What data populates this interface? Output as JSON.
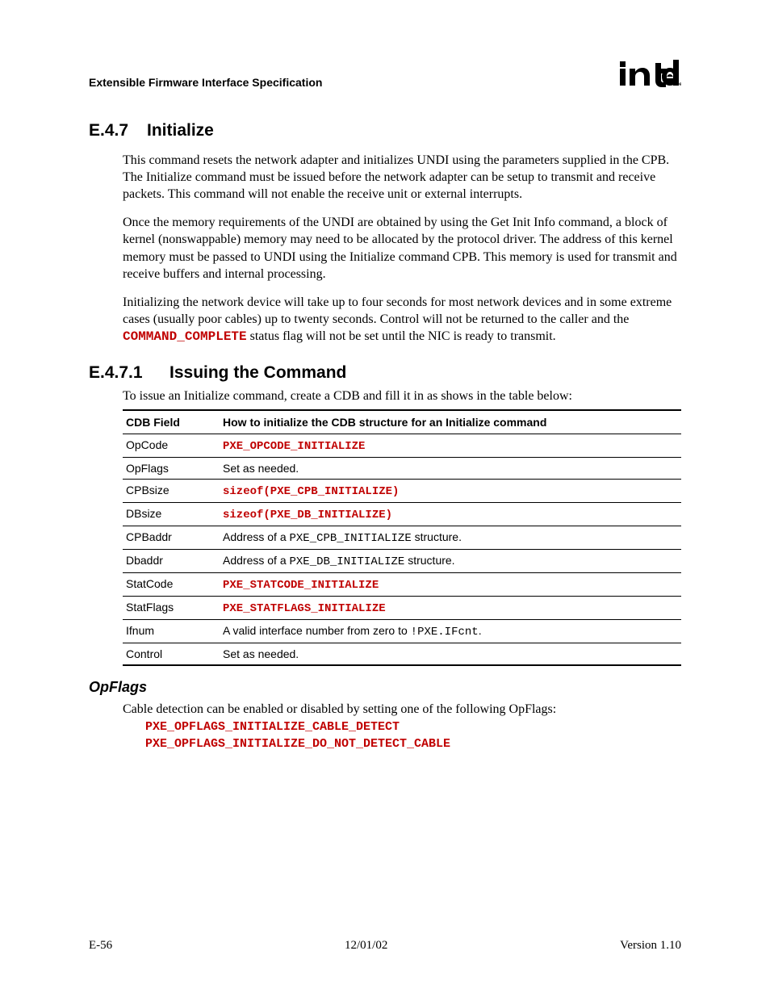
{
  "header": {
    "doc_title": "Extensible Firmware Interface Specification",
    "logo_alt": "intel"
  },
  "section": {
    "num": "E.4.7",
    "title": "Initialize",
    "paras": [
      "This command resets the network adapter and initializes UNDI using the parameters supplied in the CPB.  The Initialize command must be issued before the network adapter can be setup to transmit and receive packets.  This command will not enable the receive unit or external interrupts.",
      "Once the memory requirements of the UNDI are obtained by using the Get Init Info command, a block of kernel (nonswappable) memory may need to be allocated by the protocol driver.  The address of this kernel memory must be passed to UNDI using the Initialize command CPB.  This memory is used for transmit and receive buffers and internal processing."
    ],
    "para3_pre": "Initializing the network device will take up to four seconds for most network devices and in some extreme cases (usually poor cables) up to twenty seconds.  Control will not be returned to the caller and the ",
    "para3_code": "COMMAND_COMPLETE",
    "para3_post": " status flag will not be set until the NIC is ready to transmit."
  },
  "sub": {
    "num": "E.4.7.1",
    "title": "Issuing the Command",
    "intro": "To issue an Initialize command, create a CDB and fill it in as shows in the table below:"
  },
  "table": {
    "col1": "CDB Field",
    "col2": "How to initialize the CDB structure for an Initialize command",
    "rows": {
      "r0": {
        "f": "OpCode",
        "v_code": "PXE_OPCODE_INITIALIZE"
      },
      "r1": {
        "f": "OpFlags",
        "v_text": "Set as needed."
      },
      "r2": {
        "f": "CPBsize",
        "v_code": "sizeof(PXE_CPB_INITIALIZE)"
      },
      "r3": {
        "f": "DBsize",
        "v_code": "sizeof(PXE_DB_INITIALIZE)"
      },
      "r4": {
        "f": "CPBaddr",
        "v_pre": "Address of a ",
        "v_code": "PXE_CPB_INITIALIZE",
        "v_post": " structure."
      },
      "r5": {
        "f": "Dbaddr",
        "v_pre": "Address of a ",
        "v_code": "PXE_DB_INITIALIZE",
        "v_post": " structure."
      },
      "r6": {
        "f": "StatCode",
        "v_code": "PXE_STATCODE_INITIALIZE"
      },
      "r7": {
        "f": "StatFlags",
        "v_code": "PXE_STATFLAGS_INITIALIZE"
      },
      "r8": {
        "f": "Ifnum",
        "v_pre": "A valid interface number from zero to ",
        "v_code": "!PXE.IFcnt",
        "v_post": "."
      },
      "r9": {
        "f": "Control",
        "v_text": "Set as needed."
      }
    }
  },
  "opflags": {
    "heading": "OpFlags",
    "intro": "Cable detection can be enabled or disabled by setting one of the following OpFlags:",
    "line1": "PXE_OPFLAGS_INITIALIZE_CABLE_DETECT",
    "line2": "PXE_OPFLAGS_INITIALIZE_DO_NOT_DETECT_CABLE"
  },
  "footer": {
    "left": "E-56",
    "center": "12/01/02",
    "right": "Version 1.10"
  }
}
